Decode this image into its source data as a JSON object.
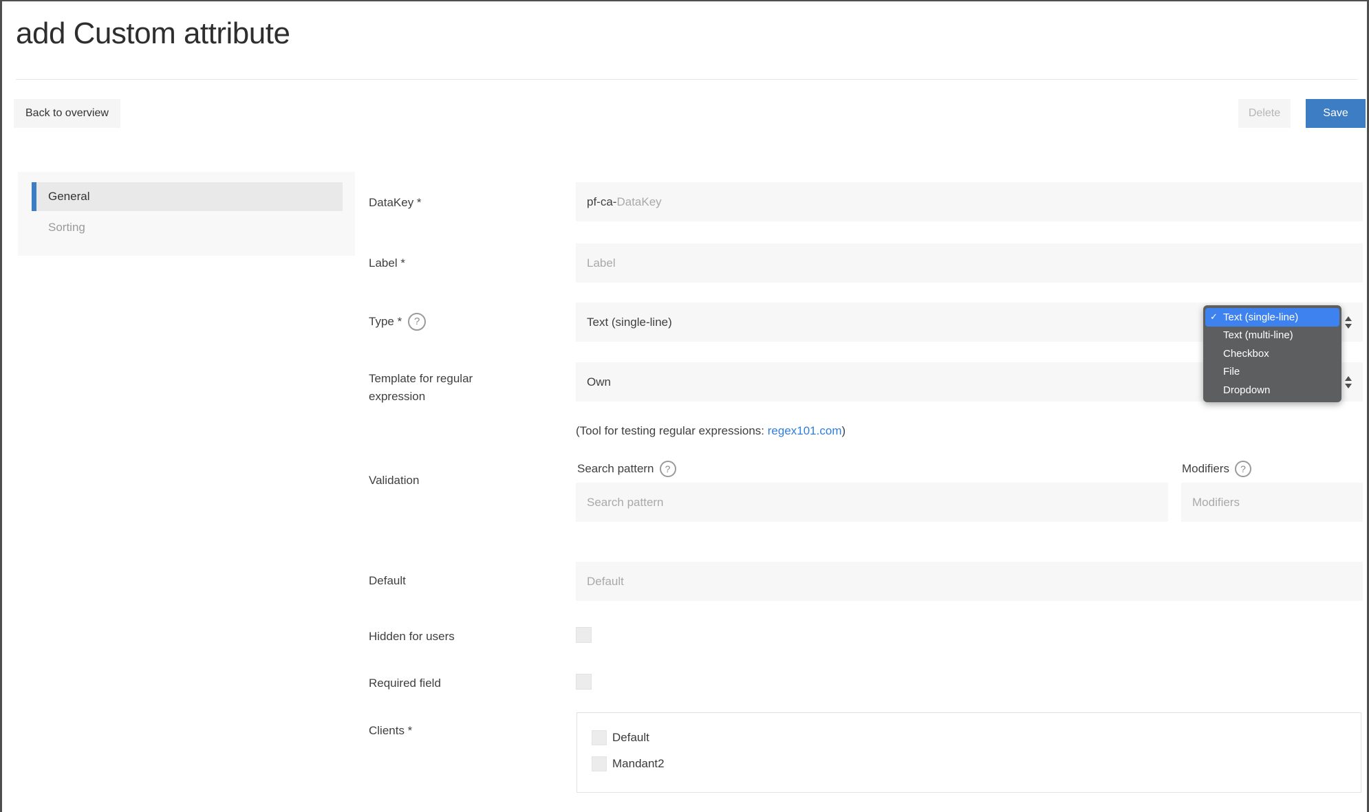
{
  "page": {
    "title": "add Custom attribute"
  },
  "toolbar": {
    "back_label": "Back to overview",
    "delete_label": "Delete",
    "save_label": "Save"
  },
  "sidebar": {
    "items": [
      {
        "label": "General",
        "active": true
      },
      {
        "label": "Sorting",
        "active": false
      }
    ]
  },
  "form": {
    "datakey": {
      "label": "DataKey *",
      "value_prefix": "pf-ca-",
      "placeholder": "DataKey"
    },
    "label_field": {
      "label": "Label *",
      "placeholder": "Label"
    },
    "type": {
      "label": "Type *",
      "value": "Text (single-line)",
      "help_icon": "?"
    },
    "template": {
      "label": "Template for regular expression",
      "value": "Own"
    },
    "regex_note": {
      "prefix": "(Tool for testing regular expressions: ",
      "link": "regex101.com",
      "suffix": ")"
    },
    "validation": {
      "label": "Validation",
      "search_pattern_label": "Search pattern",
      "search_pattern_placeholder": "Search pattern",
      "modifiers_label": "Modifiers",
      "modifiers_placeholder": "Modifiers"
    },
    "default_field": {
      "label": "Default",
      "placeholder": "Default"
    },
    "hidden_for_users": {
      "label": "Hidden for users",
      "checked": false
    },
    "required_field": {
      "label": "Required field",
      "checked": false
    },
    "clients": {
      "label": "Clients *",
      "options": [
        {
          "label": "Default",
          "checked": false
        },
        {
          "label": "Mandant2",
          "checked": false
        }
      ]
    }
  },
  "type_dropdown": {
    "check_glyph": "✓",
    "options": [
      {
        "label": "Text (single-line)",
        "selected": true
      },
      {
        "label": "Text (multi-line)",
        "selected": false
      },
      {
        "label": "Checkbox",
        "selected": false
      },
      {
        "label": "File",
        "selected": false
      },
      {
        "label": "Dropdown",
        "selected": false
      }
    ]
  },
  "colors": {
    "accent_blue": "#3c7dc4",
    "dropdown_highlight_blue": "#3e82f0",
    "dropdown_bg": "#5d5e60",
    "link_blue": "#2f7de1",
    "input_bg": "#f7f7f7"
  }
}
